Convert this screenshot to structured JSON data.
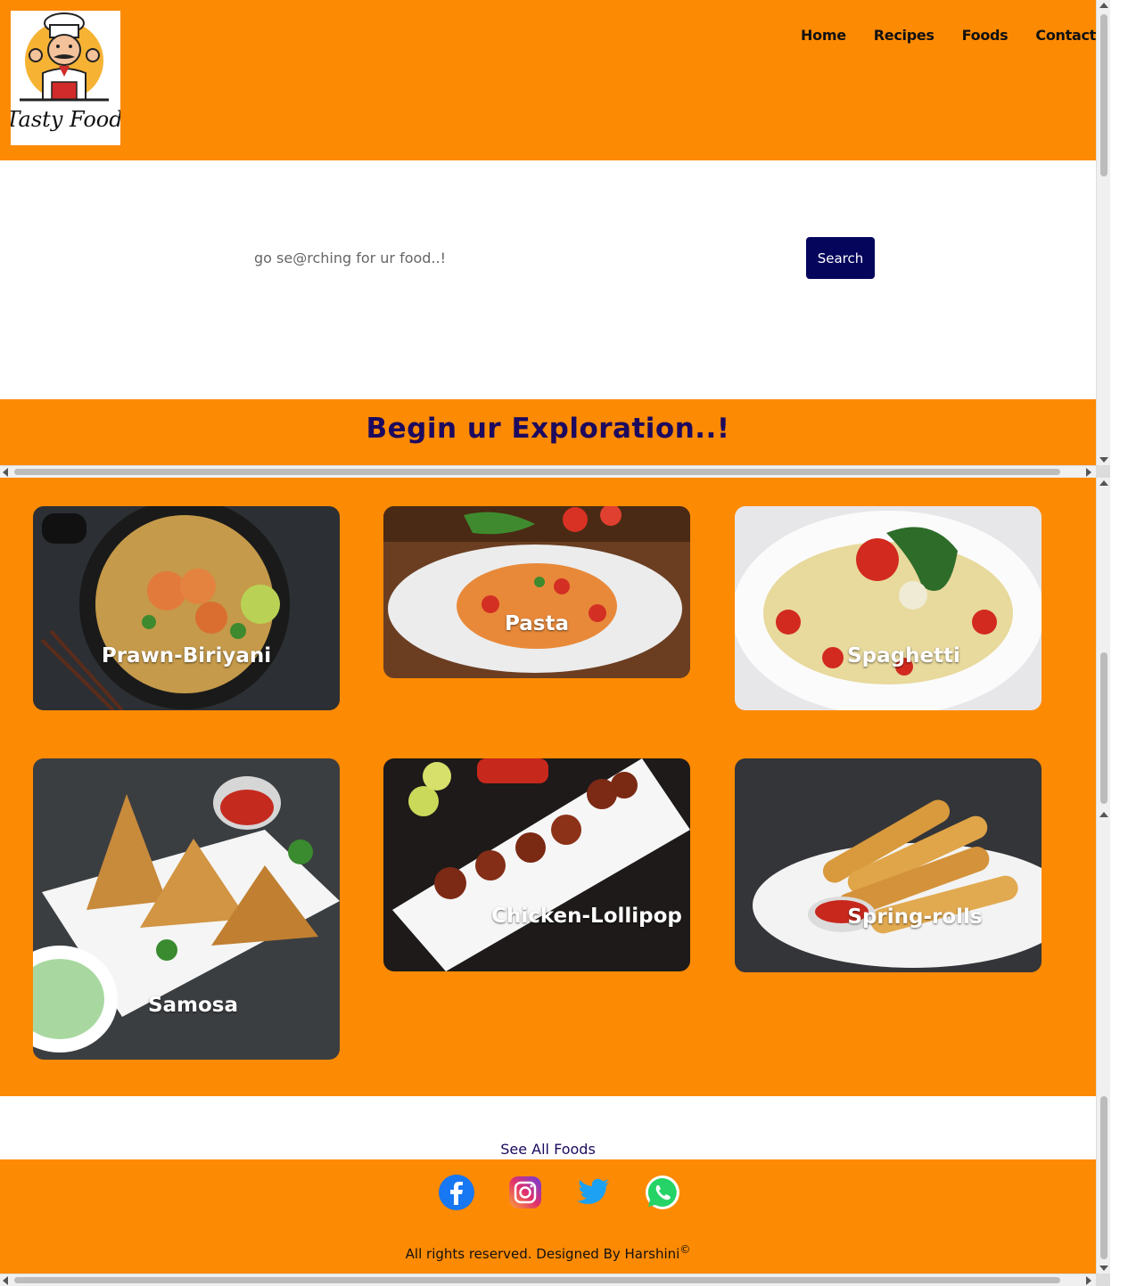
{
  "brand": {
    "logo_text": "Tasty Food"
  },
  "nav": {
    "items": [
      {
        "label": "Home"
      },
      {
        "label": "Recipes"
      },
      {
        "label": "Foods"
      },
      {
        "label": "Contact"
      }
    ]
  },
  "search": {
    "placeholder": "go se@rching for ur food..!",
    "button_label": "Search"
  },
  "explore": {
    "title": "Begin ur Exploration..!"
  },
  "foods": [
    {
      "name": "Prawn-Biriyani"
    },
    {
      "name": "Pasta"
    },
    {
      "name": "Spaghetti"
    },
    {
      "name": "Samosa"
    },
    {
      "name": "Chicken-Lollipop"
    },
    {
      "name": "Spring-rolls"
    }
  ],
  "see_all": {
    "label": "See All Foods"
  },
  "footer": {
    "socials": [
      {
        "icon": "facebook-icon"
      },
      {
        "icon": "instagram-icon"
      },
      {
        "icon": "twitter-icon"
      },
      {
        "icon": "whatsapp-icon"
      }
    ],
    "copyright": "All rights reserved. Designed By Harshini",
    "copyright_mark": "©"
  },
  "colors": {
    "brand_orange": "#fd8a03",
    "navy": "#06055c",
    "title_purple": "#1d0a5e"
  }
}
